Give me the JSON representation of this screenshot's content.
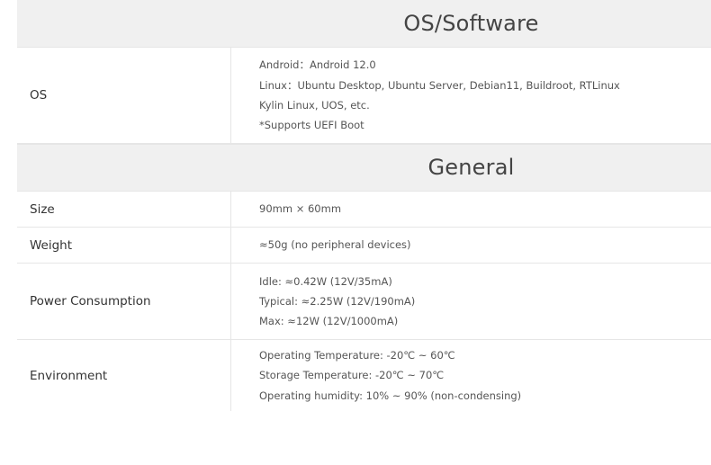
{
  "os_section": {
    "title": "OS/Software",
    "row": {
      "label": "OS",
      "lines": [
        "Android：Android 12.0",
        "Linux：Ubuntu Desktop, Ubuntu Server, Debian11, Buildroot, RTLinux",
        "Kylin Linux, UOS, etc.",
        "*Supports UEFI Boot"
      ]
    }
  },
  "general_section": {
    "title": "General",
    "rows": [
      {
        "label": "Size",
        "lines": [
          "90mm × 60mm"
        ]
      },
      {
        "label": "Weight",
        "lines": [
          "≈50g (no peripheral devices)"
        ]
      },
      {
        "label": "Power Consumption",
        "lines": [
          "Idle: ≈0.42W (12V/35mA)",
          "Typical: ≈2.25W (12V/190mA)",
          "Max: ≈12W (12V/1000mA)"
        ]
      },
      {
        "label": "Environment",
        "lines": [
          "Operating Temperature: -20℃ ~ 60℃",
          "Storage Temperature: -20℃ ~ 70℃",
          "Operating humidity: 10% ~ 90% (non-condensing)"
        ]
      }
    ]
  }
}
